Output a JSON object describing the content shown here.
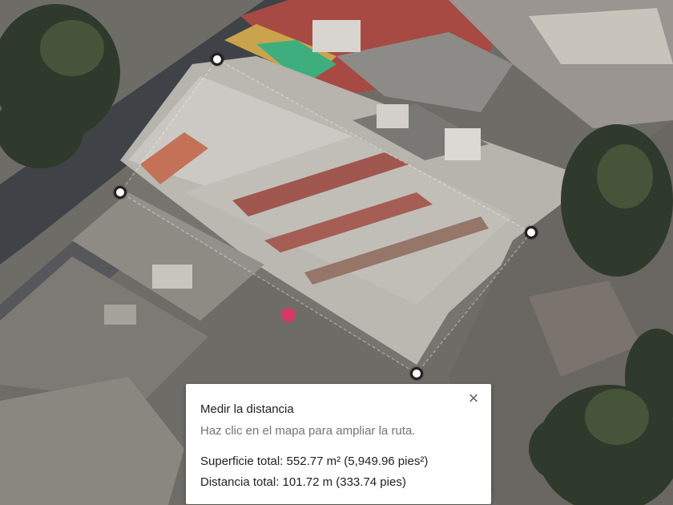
{
  "panel": {
    "title": "Medir la distancia",
    "hint": "Haz clic en el mapa para ampliar la ruta.",
    "area": "Superficie total: 552.77 m² (5,949.96 pies²)",
    "distance": "Distancia total: 101.72 m (333.74 pies)",
    "close_icon": "×"
  },
  "map": {
    "view": "satellite-3d",
    "vertex_count": 4
  }
}
